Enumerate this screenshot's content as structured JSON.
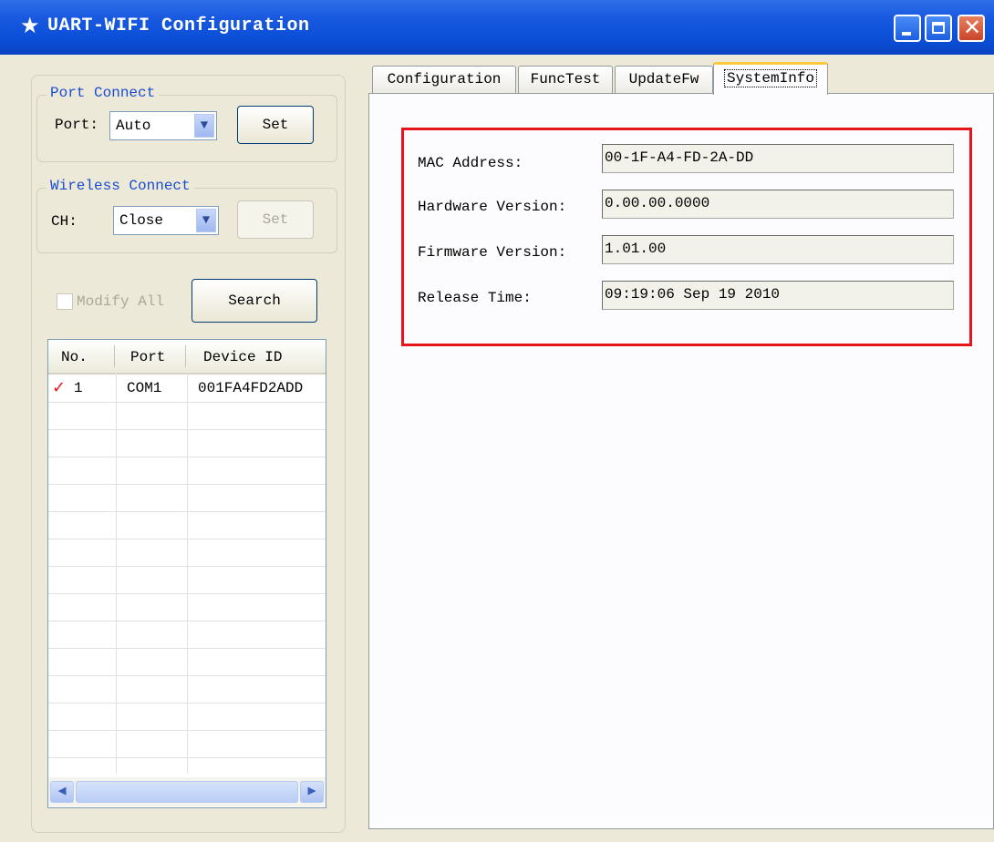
{
  "window": {
    "title": "UART-WIFI Configuration"
  },
  "port_connect": {
    "group_title": "Port Connect",
    "port_label": "Port:",
    "port_value": "Auto",
    "set_label": "Set"
  },
  "wireless_connect": {
    "group_title": "Wireless Connect",
    "ch_label": "CH:",
    "ch_value": "Close",
    "set_label": "Set"
  },
  "modify_all": {
    "label": "Modify All",
    "checked": false
  },
  "search_button": "Search",
  "device_list": {
    "columns": [
      "No.",
      "Port",
      "Device ID"
    ],
    "rows": [
      {
        "no": "1",
        "port": "COM1",
        "device_id": "001FA4FD2ADD",
        "checked": true
      }
    ]
  },
  "tabs": [
    {
      "label": "Configuration"
    },
    {
      "label": "FuncTest"
    },
    {
      "label": "UpdateFw"
    },
    {
      "label": "SystemInfo",
      "active": true
    }
  ],
  "system_info": {
    "mac_label": "MAC Address:",
    "mac_value": "00-1F-A4-FD-2A-DD",
    "hw_label": "Hardware Version:",
    "hw_value": "0.00.00.0000",
    "fw_label": "Firmware Version:",
    "fw_value": "1.01.00",
    "release_label": "Release Time:",
    "release_value": "09:19:06 Sep 19 2010"
  },
  "colors": {
    "title_bar": "#0b4fd8",
    "highlight_box": "#e8141c",
    "group_title": "#1a4cd0",
    "window_bg": "#ece9d8"
  }
}
